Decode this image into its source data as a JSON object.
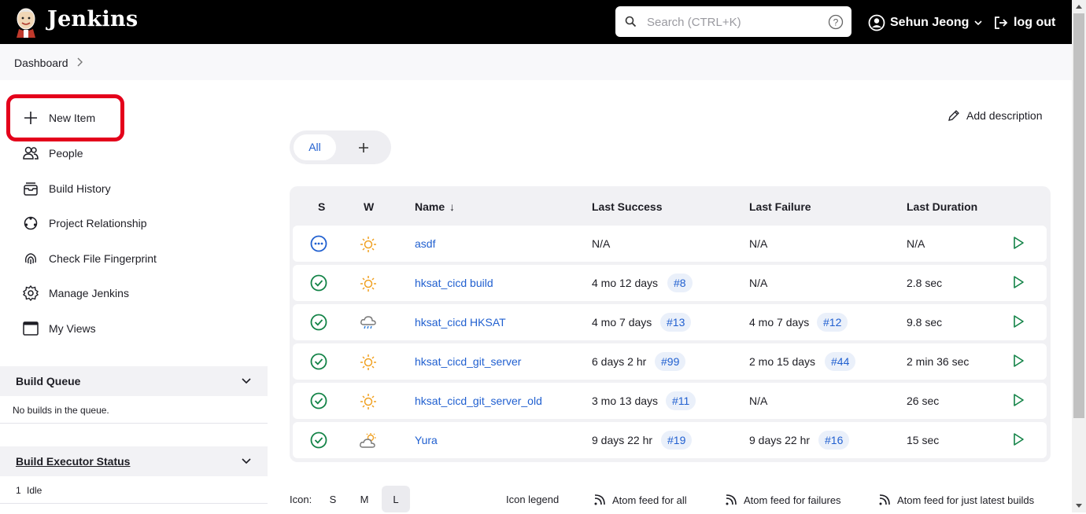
{
  "header": {
    "brand": "Jenkins",
    "search_placeholder": "Search (CTRL+K)",
    "user_name": "Sehun Jeong",
    "logout_label": "log out"
  },
  "breadcrumb": {
    "item": "Dashboard"
  },
  "sidebar": {
    "tasks": [
      {
        "label": "New Item",
        "icon": "plus-icon"
      },
      {
        "label": "People",
        "icon": "people-icon"
      },
      {
        "label": "Build History",
        "icon": "build-history-icon"
      },
      {
        "label": "Project Relationship",
        "icon": "relationship-icon"
      },
      {
        "label": "Check File Fingerprint",
        "icon": "fingerprint-icon"
      },
      {
        "label": "Manage Jenkins",
        "icon": "gear-icon"
      },
      {
        "label": "My Views",
        "icon": "window-icon"
      }
    ],
    "build_queue": {
      "title": "Build Queue",
      "empty_text": "No builds in the queue."
    },
    "executor": {
      "title": "Build Executor Status",
      "number": "1",
      "status": "Idle"
    }
  },
  "main": {
    "add_description": "Add description",
    "tabs": {
      "all": "All"
    },
    "table": {
      "headers": {
        "s": "S",
        "w": "W",
        "name": "Name",
        "sort_arrow": "↓",
        "last_success": "Last Success",
        "last_failure": "Last Failure",
        "last_duration": "Last Duration"
      },
      "rows": [
        {
          "status": "in-progress",
          "weather": "sunny",
          "name": "asdf",
          "success": "N/A",
          "success_build": "",
          "failure": "N/A",
          "failure_build": "",
          "duration": "N/A"
        },
        {
          "status": "success",
          "weather": "sunny",
          "name": "hksat_cicd build",
          "success": "4 mo 12 days",
          "success_build": "#8",
          "failure": "N/A",
          "failure_build": "",
          "duration": "2.8 sec"
        },
        {
          "status": "success",
          "weather": "rainy",
          "name": "hksat_cicd HKSAT",
          "success": "4 mo 7 days",
          "success_build": "#13",
          "failure": "4 mo 7 days",
          "failure_build": "#12",
          "duration": "9.8 sec"
        },
        {
          "status": "success",
          "weather": "sunny",
          "name": "hksat_cicd_git_server",
          "success": "6 days 2 hr",
          "success_build": "#99",
          "failure": "2 mo 15 days",
          "failure_build": "#44",
          "duration": "2 min 36 sec"
        },
        {
          "status": "success",
          "weather": "sunny",
          "name": "hksat_cicd_git_server_old",
          "success": "3 mo 13 days",
          "success_build": "#11",
          "failure": "N/A",
          "failure_build": "",
          "duration": "26 sec"
        },
        {
          "status": "success",
          "weather": "partly-cloudy",
          "name": "Yura",
          "success": "9 days 22 hr",
          "success_build": "#19",
          "failure": "9 days 22 hr",
          "failure_build": "#16",
          "duration": "15 sec"
        }
      ]
    },
    "footer": {
      "icon_label": "Icon:",
      "sizes": [
        "S",
        "M",
        "L"
      ],
      "selected_size": "L",
      "icon_legend": "Icon legend",
      "atom_all": "Atom feed for all",
      "atom_failures": "Atom feed for failures",
      "atom_latest": "Atom feed for just latest builds"
    }
  },
  "colors": {
    "header_bg": "#000000",
    "link": "#2160d0",
    "success": "#138347",
    "highlight": "#e4001b"
  }
}
